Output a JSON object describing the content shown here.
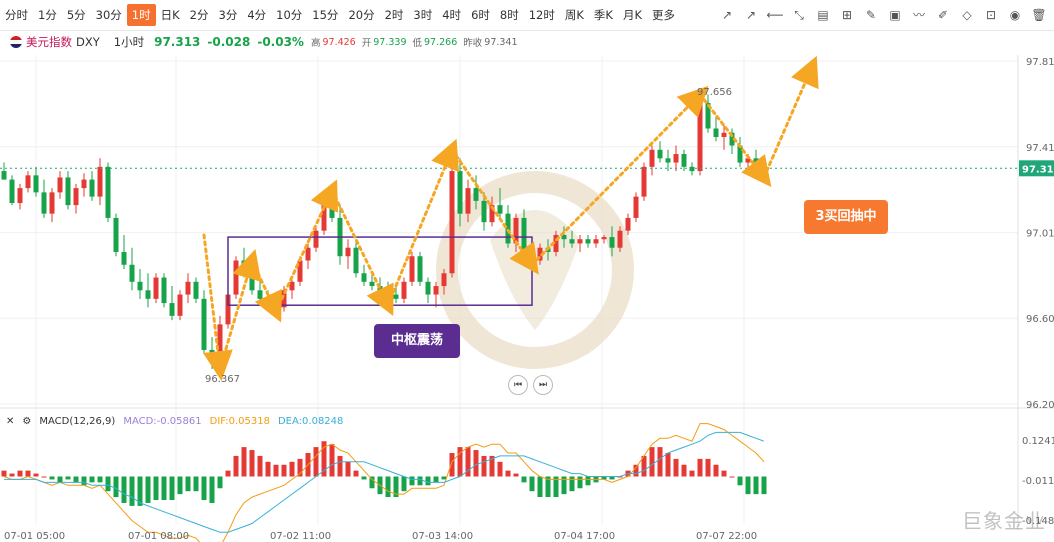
{
  "toolbar": {
    "timeframes": [
      "分时",
      "1分",
      "5分",
      "30分",
      "1时",
      "日K",
      "2分",
      "3分",
      "4分",
      "10分",
      "15分",
      "20分",
      "2时",
      "3时",
      "4时",
      "6时",
      "8时",
      "12时",
      "周K",
      "季K",
      "月K",
      "更多"
    ],
    "active_timeframe": "1时"
  },
  "quote": {
    "symbol_name": "美元指数",
    "symbol_code": "DXY",
    "period": "1小时",
    "last": "97.313",
    "change": "-0.028",
    "change_pct": "-0.03%",
    "high_label": "高",
    "high": "97.426",
    "open_label": "开",
    "open": "97.339",
    "low_label": "低",
    "low": "97.266",
    "prev_label": "昨收",
    "prev": "97.341"
  },
  "macd_legend": {
    "title": "MACD(12,26,9)",
    "macd": "MACD:-0.05861",
    "dif": "DIF:0.05318",
    "dea": "DEA:0.08248"
  },
  "annotations": {
    "pivot_label": "中枢震荡",
    "buy3_label": "3买回抽中",
    "peak_label": "97.656",
    "low_label": "96.367"
  },
  "watermark": "巨象金业",
  "colors": {
    "up": "#e53935",
    "down": "#17a34a",
    "arrow": "#f5a623",
    "box": "#5b2d90",
    "price_line": "#1fa77a"
  },
  "chart_data": {
    "type": "candlestick",
    "title": "",
    "ylim": [
      96.206,
      97.817
    ],
    "y_ticks": [
      97.817,
      97.414,
      97.011,
      96.609,
      96.206
    ],
    "current_price": 97.313,
    "x_tick_labels": [
      "07-01 05:00",
      "07-01 08:00",
      "07-02 11:00",
      "07-03 14:00",
      "07-04 17:00",
      "07-07 22:00"
    ],
    "candles": [
      [
        97.3,
        97.34,
        97.26,
        97.26
      ],
      [
        97.26,
        97.28,
        97.14,
        97.15
      ],
      [
        97.15,
        97.24,
        97.12,
        97.22
      ],
      [
        97.22,
        97.3,
        97.2,
        97.28
      ],
      [
        97.28,
        97.32,
        97.18,
        97.2
      ],
      [
        97.2,
        97.26,
        97.08,
        97.1
      ],
      [
        97.1,
        97.22,
        97.06,
        97.2
      ],
      [
        97.2,
        97.3,
        97.17,
        97.27
      ],
      [
        97.27,
        97.3,
        97.12,
        97.14
      ],
      [
        97.14,
        97.24,
        97.1,
        97.22
      ],
      [
        97.22,
        97.29,
        97.18,
        97.26
      ],
      [
        97.26,
        97.3,
        97.16,
        97.18
      ],
      [
        97.18,
        97.36,
        97.14,
        97.32
      ],
      [
        97.32,
        97.34,
        97.06,
        97.08
      ],
      [
        97.08,
        97.1,
        96.9,
        96.92
      ],
      [
        96.92,
        97.0,
        96.84,
        96.86
      ],
      [
        96.86,
        96.94,
        96.74,
        96.78
      ],
      [
        96.78,
        96.84,
        96.7,
        96.74
      ],
      [
        96.74,
        96.82,
        96.66,
        96.7
      ],
      [
        96.7,
        96.82,
        96.68,
        96.8
      ],
      [
        96.8,
        96.82,
        96.66,
        96.68
      ],
      [
        96.68,
        96.76,
        96.6,
        96.62
      ],
      [
        96.62,
        96.74,
        96.6,
        96.72
      ],
      [
        96.72,
        96.82,
        96.68,
        96.78
      ],
      [
        96.78,
        96.8,
        96.68,
        96.7
      ],
      [
        96.7,
        96.74,
        96.44,
        96.46
      ],
      [
        96.46,
        96.52,
        96.37,
        96.42
      ],
      [
        96.42,
        96.62,
        96.4,
        96.58
      ],
      [
        96.58,
        96.74,
        96.56,
        96.72
      ],
      [
        96.72,
        96.9,
        96.7,
        96.88
      ],
      [
        96.88,
        96.94,
        96.8,
        96.84
      ],
      [
        96.84,
        96.86,
        96.72,
        96.74
      ],
      [
        96.74,
        96.8,
        96.68,
        96.7
      ],
      [
        96.7,
        96.74,
        96.64,
        96.68
      ],
      [
        96.68,
        96.72,
        96.64,
        96.66
      ],
      [
        96.66,
        96.76,
        96.64,
        96.74
      ],
      [
        96.74,
        96.8,
        96.7,
        96.78
      ],
      [
        96.78,
        96.9,
        96.76,
        96.88
      ],
      [
        96.88,
        96.96,
        96.84,
        96.94
      ],
      [
        96.94,
        97.04,
        96.92,
        97.02
      ],
      [
        97.02,
        97.16,
        97.0,
        97.14
      ],
      [
        97.14,
        97.2,
        97.06,
        97.08
      ],
      [
        97.08,
        97.14,
        96.86,
        96.9
      ],
      [
        96.9,
        96.98,
        96.84,
        96.94
      ],
      [
        96.94,
        96.98,
        96.8,
        96.82
      ],
      [
        96.82,
        96.86,
        96.76,
        96.78
      ],
      [
        96.78,
        96.82,
        96.74,
        96.76
      ],
      [
        96.76,
        96.8,
        96.72,
        96.74
      ],
      [
        96.74,
        96.78,
        96.7,
        96.72
      ],
      [
        96.72,
        96.76,
        96.68,
        96.7
      ],
      [
        96.7,
        96.8,
        96.68,
        96.78
      ],
      [
        96.78,
        96.92,
        96.76,
        96.9
      ],
      [
        96.9,
        96.92,
        96.76,
        96.78
      ],
      [
        96.78,
        96.8,
        96.68,
        96.72
      ],
      [
        96.72,
        96.78,
        96.66,
        96.76
      ],
      [
        96.76,
        96.84,
        96.72,
        96.82
      ],
      [
        96.82,
        97.4,
        96.8,
        97.3
      ],
      [
        97.3,
        97.36,
        97.04,
        97.1
      ],
      [
        97.1,
        97.26,
        97.06,
        97.22
      ],
      [
        97.22,
        97.28,
        97.12,
        97.16
      ],
      [
        97.16,
        97.2,
        97.02,
        97.06
      ],
      [
        97.06,
        97.18,
        97.04,
        97.14
      ],
      [
        97.14,
        97.22,
        97.08,
        97.1
      ],
      [
        97.1,
        97.14,
        96.94,
        96.96
      ],
      [
        96.96,
        97.1,
        96.92,
        97.08
      ],
      [
        97.08,
        97.12,
        96.9,
        96.92
      ],
      [
        96.92,
        96.98,
        96.84,
        96.88
      ],
      [
        96.88,
        96.96,
        96.86,
        96.94
      ],
      [
        96.94,
        96.98,
        96.88,
        96.92
      ],
      [
        96.92,
        97.02,
        96.9,
        97.0
      ],
      [
        97.0,
        97.04,
        96.94,
        96.98
      ],
      [
        96.98,
        97.02,
        96.94,
        96.96
      ],
      [
        96.96,
        97.0,
        96.92,
        96.98
      ],
      [
        96.98,
        97.0,
        96.94,
        96.96
      ],
      [
        96.96,
        97.0,
        96.94,
        96.98
      ],
      [
        96.98,
        97.0,
        96.96,
        96.99
      ],
      [
        96.99,
        97.04,
        96.9,
        96.94
      ],
      [
        96.94,
        97.04,
        96.92,
        97.02
      ],
      [
        97.02,
        97.1,
        97.0,
        97.08
      ],
      [
        97.08,
        97.2,
        97.06,
        97.18
      ],
      [
        97.18,
        97.34,
        97.16,
        97.32
      ],
      [
        97.32,
        97.42,
        97.28,
        97.4
      ],
      [
        97.4,
        97.44,
        97.34,
        97.36
      ],
      [
        97.36,
        97.4,
        97.3,
        97.34
      ],
      [
        97.34,
        97.42,
        97.3,
        97.38
      ],
      [
        97.38,
        97.4,
        97.3,
        97.32
      ],
      [
        97.32,
        97.34,
        97.28,
        97.3
      ],
      [
        97.3,
        97.66,
        97.28,
        97.62
      ],
      [
        97.62,
        97.66,
        97.48,
        97.5
      ],
      [
        97.5,
        97.56,
        97.44,
        97.46
      ],
      [
        97.46,
        97.52,
        97.4,
        97.48
      ],
      [
        97.48,
        97.5,
        97.38,
        97.42
      ],
      [
        97.42,
        97.46,
        97.32,
        97.34
      ],
      [
        97.34,
        97.38,
        97.3,
        97.36
      ],
      [
        97.36,
        97.4,
        97.28,
        97.3
      ],
      [
        97.3,
        97.33,
        97.27,
        97.31
      ]
    ],
    "macd": {
      "histogram": [
        0.02,
        0.01,
        0.02,
        0.02,
        0.01,
        0.0,
        -0.01,
        -0.02,
        -0.01,
        -0.02,
        -0.03,
        -0.02,
        -0.02,
        -0.05,
        -0.07,
        -0.09,
        -0.1,
        -0.1,
        -0.09,
        -0.08,
        -0.08,
        -0.08,
        -0.06,
        -0.05,
        -0.05,
        -0.08,
        -0.09,
        -0.04,
        0.02,
        0.07,
        0.1,
        0.09,
        0.07,
        0.05,
        0.04,
        0.04,
        0.05,
        0.06,
        0.08,
        0.1,
        0.12,
        0.11,
        0.07,
        0.05,
        0.02,
        -0.01,
        -0.04,
        -0.06,
        -0.07,
        -0.07,
        -0.05,
        -0.03,
        -0.03,
        -0.03,
        -0.02,
        -0.01,
        0.08,
        0.1,
        0.1,
        0.09,
        0.07,
        0.07,
        0.05,
        0.02,
        0.01,
        -0.02,
        -0.05,
        -0.07,
        -0.07,
        -0.07,
        -0.06,
        -0.05,
        -0.04,
        -0.03,
        -0.02,
        -0.01,
        -0.01,
        0.0,
        0.02,
        0.04,
        0.07,
        0.1,
        0.1,
        0.08,
        0.06,
        0.04,
        0.02,
        0.06,
        0.06,
        0.04,
        0.02,
        0.0,
        -0.03,
        -0.06,
        -0.06,
        -0.06
      ],
      "dif": [
        0.0,
        -0.01,
        -0.01,
        0.0,
        -0.01,
        -0.02,
        -0.03,
        -0.02,
        -0.03,
        -0.03,
        -0.03,
        -0.04,
        -0.03,
        -0.06,
        -0.09,
        -0.12,
        -0.15,
        -0.17,
        -0.19,
        -0.19,
        -0.2,
        -0.21,
        -0.21,
        -0.2,
        -0.21,
        -0.24,
        -0.26,
        -0.24,
        -0.19,
        -0.13,
        -0.09,
        -0.07,
        -0.06,
        -0.05,
        -0.04,
        -0.03,
        -0.01,
        0.01,
        0.04,
        0.07,
        0.1,
        0.11,
        0.09,
        0.08,
        0.05,
        0.02,
        -0.01,
        -0.03,
        -0.05,
        -0.06,
        -0.06,
        -0.04,
        -0.04,
        -0.04,
        -0.04,
        -0.03,
        0.05,
        0.08,
        0.1,
        0.11,
        0.1,
        0.11,
        0.11,
        0.08,
        0.08,
        0.05,
        0.02,
        0.0,
        -0.01,
        -0.01,
        -0.01,
        -0.01,
        -0.01,
        -0.01,
        -0.01,
        -0.01,
        -0.02,
        -0.01,
        0.0,
        0.03,
        0.07,
        0.11,
        0.13,
        0.13,
        0.14,
        0.13,
        0.12,
        0.18,
        0.18,
        0.17,
        0.16,
        0.14,
        0.12,
        0.1,
        0.08,
        0.05
      ],
      "dea": [
        -0.01,
        -0.01,
        -0.01,
        -0.01,
        -0.01,
        -0.02,
        -0.02,
        -0.02,
        -0.02,
        -0.02,
        -0.02,
        -0.03,
        -0.03,
        -0.03,
        -0.04,
        -0.06,
        -0.07,
        -0.09,
        -0.1,
        -0.11,
        -0.12,
        -0.13,
        -0.14,
        -0.15,
        -0.16,
        -0.17,
        -0.18,
        -0.19,
        -0.19,
        -0.18,
        -0.17,
        -0.16,
        -0.14,
        -0.12,
        -0.1,
        -0.08,
        -0.06,
        -0.04,
        -0.02,
        0.0,
        0.02,
        0.04,
        0.05,
        0.05,
        0.05,
        0.05,
        0.04,
        0.03,
        0.02,
        0.01,
        0.0,
        -0.01,
        -0.01,
        -0.02,
        -0.02,
        -0.02,
        -0.01,
        0.0,
        0.02,
        0.04,
        0.05,
        0.06,
        0.07,
        0.07,
        0.07,
        0.07,
        0.06,
        0.05,
        0.04,
        0.03,
        0.02,
        0.01,
        0.01,
        0.0,
        0.0,
        0.0,
        0.0,
        0.0,
        0.01,
        0.01,
        0.02,
        0.04,
        0.06,
        0.08,
        0.09,
        0.1,
        0.11,
        0.12,
        0.14,
        0.15,
        0.15,
        0.15,
        0.15,
        0.14,
        0.13,
        0.12
      ],
      "y_ticks": [
        0.12419,
        -0.01192,
        -0.14803
      ]
    },
    "zigzag_path": [
      [
        25,
        97.0
      ],
      [
        27,
        96.37
      ],
      [
        31,
        96.88
      ],
      [
        34,
        96.64
      ],
      [
        41,
        97.21
      ],
      [
        48,
        96.67
      ],
      [
        56,
        97.4
      ],
      [
        66,
        96.86
      ],
      [
        87,
        97.66
      ],
      [
        95,
        97.27
      ],
      [
        101,
        97.79
      ]
    ],
    "pivot_box": {
      "x": [
        28,
        66
      ],
      "y": [
        96.67,
        96.99
      ]
    }
  }
}
